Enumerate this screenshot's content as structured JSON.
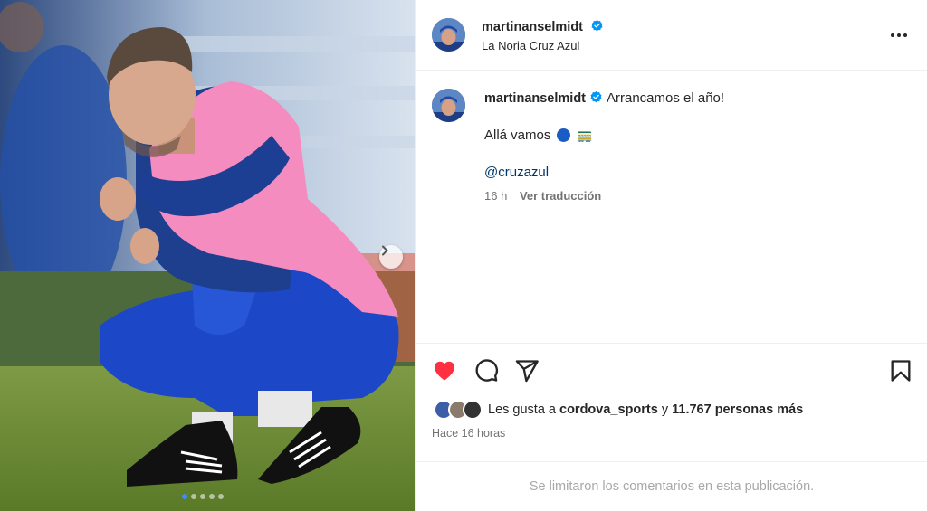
{
  "post": {
    "username": "martinanselmidt",
    "location": "La Noria Cruz Azul",
    "caption_text": "Arrancamos el año!",
    "caption_line2": "Allá vamos",
    "caption_emoji_tram": "🚃",
    "mention": "@cruzazul",
    "time_short": "16 h",
    "translate_label": "Ver traducción",
    "likes_prefix": "Les gusta a",
    "likes_user": "cordova_sports",
    "likes_middle": "y",
    "likes_count": "11.767 personas más",
    "time_long": "Hace 16 horas",
    "comments_disabled": "Se limitaron los comentarios en esta publicación."
  },
  "carousel": {
    "total": 5,
    "active_index": 0
  },
  "icons": {
    "verified": "verified-badge-icon",
    "more": "more-options-icon",
    "like": "heart-icon",
    "comment": "comment-icon",
    "share": "share-icon",
    "save": "bookmark-icon",
    "next": "chevron-right-icon"
  },
  "colors": {
    "verified_blue": "#0095f6",
    "like_red": "#ff3040",
    "mention_blue": "#00376b",
    "muted_text": "#737373"
  }
}
